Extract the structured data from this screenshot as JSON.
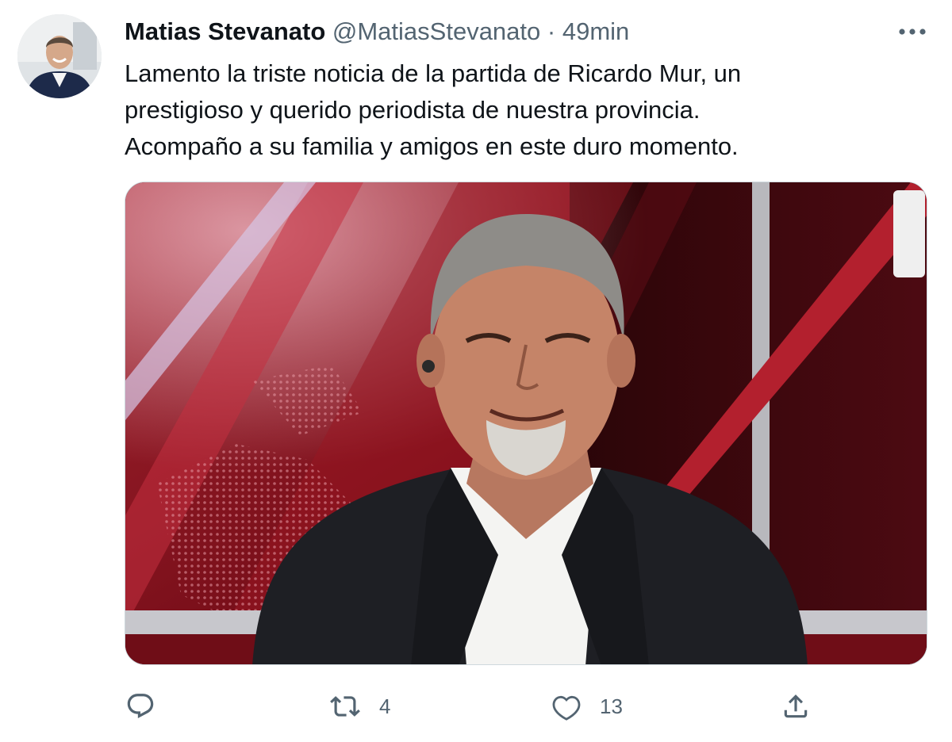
{
  "tweet": {
    "author": {
      "name": "Matias Stevanato",
      "handle": "@MatiasStevanato",
      "separator": "·",
      "time": "49min"
    },
    "text_lines": [
      "Lamento la triste noticia de la partida de Ricardo Mur, un",
      "prestigioso y querido periodista de nuestra provincia.",
      "Acompaño a su familia y amigos en este duro momento."
    ],
    "media": {
      "icon": "photo-of-smiling-man-in-tv-studio"
    },
    "actions": {
      "reply_count": "",
      "retweet_count": "4",
      "like_count": "13"
    }
  },
  "colors": {
    "text_primary": "#0f1419",
    "text_secondary": "#536471",
    "border": "#cfd9de"
  },
  "icons": [
    "more-icon",
    "reply-icon",
    "retweet-icon",
    "like-icon",
    "share-icon"
  ]
}
